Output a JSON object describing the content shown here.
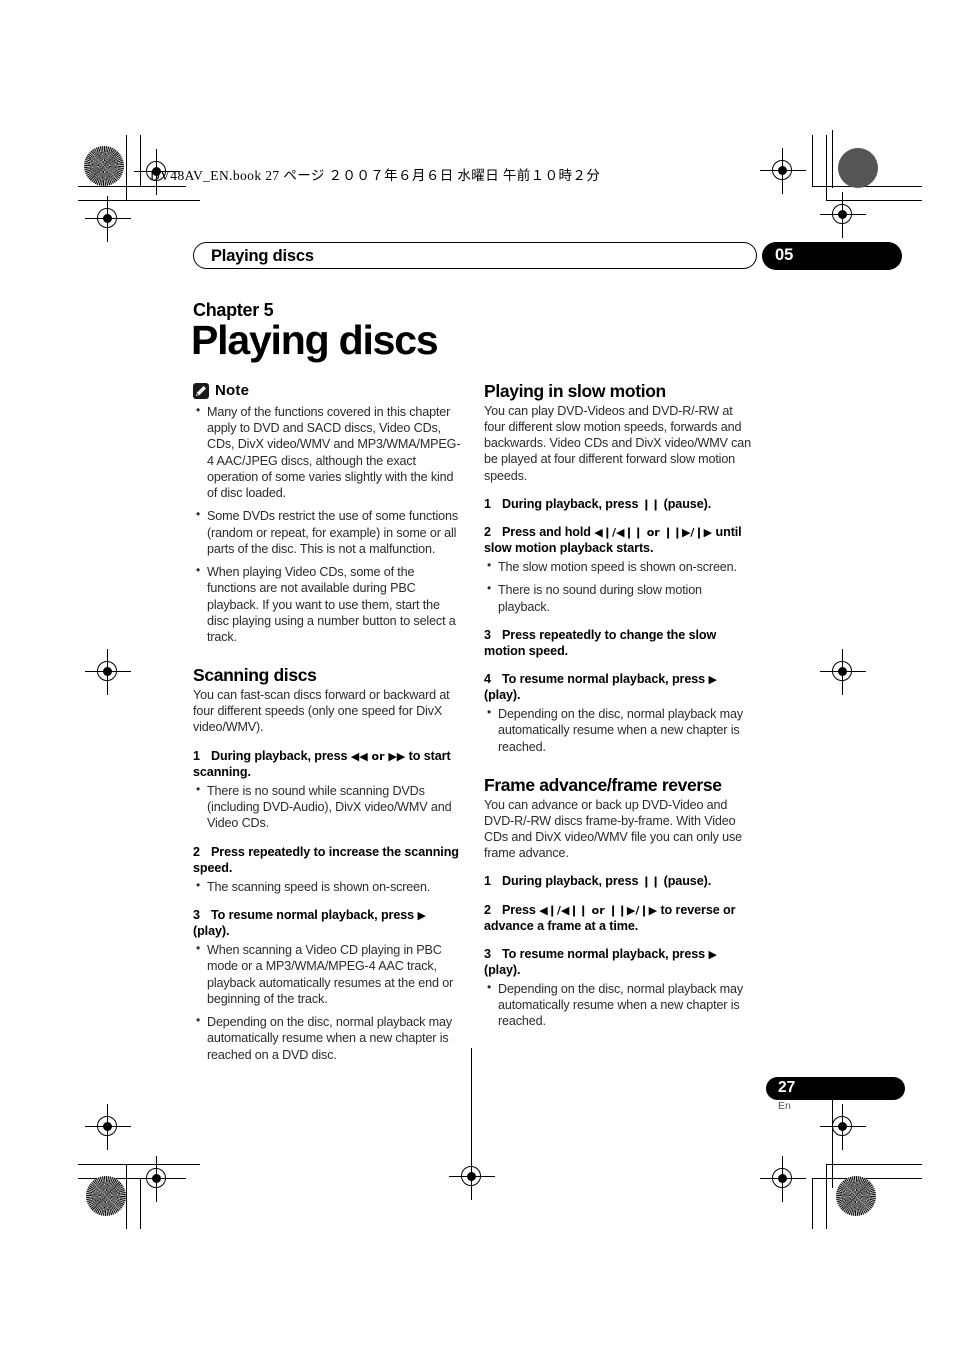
{
  "print_header": {
    "text": "DV48AV_EN.book  27 ページ  ２００７年６月６日  水曜日  午前１０時２分"
  },
  "running_header": {
    "title": "Playing discs",
    "chapter_number": "05"
  },
  "chapter": {
    "label": "Chapter 5",
    "title": "Playing discs"
  },
  "left_column": {
    "note": {
      "icon": "pencil-icon",
      "label": "Note",
      "items": [
        "Many of the functions covered in this chapter apply to DVD and SACD discs, Video CDs, CDs, DivX video/WMV and MP3/WMA/MPEG-4 AAC/JPEG discs, although the exact operation of some varies slightly with the kind of disc loaded.",
        "Some DVDs restrict the use of some functions (random or repeat, for example) in some or all parts of the disc. This is not a malfunction.",
        "When playing Video CDs, some of the functions are not available during PBC playback. If you want to use them, start the disc playing using a number button to select a track."
      ]
    },
    "scanning": {
      "heading": "Scanning discs",
      "intro": "You can fast-scan discs forward or backward at four different speeds (only one speed for DivX video/WMV).",
      "steps": [
        {
          "number": "1",
          "text_before": "During playback, press ",
          "symbol": "◀◀ or ▶▶",
          "text_after": " to start scanning.",
          "bullets": [
            "There is no sound while scanning DVDs (including DVD-Audio), DivX video/WMV and Video CDs."
          ]
        },
        {
          "number": "2",
          "text_before": "Press repeatedly to increase the scanning speed.",
          "symbol": "",
          "text_after": "",
          "bullets": [
            "The scanning speed is shown on-screen."
          ]
        },
        {
          "number": "3",
          "text_before": "To resume normal playback, press ",
          "symbol": "▶",
          "text_after": " (play).",
          "bullets": [
            "When scanning a Video CD playing in PBC mode or a MP3/WMA/MPEG-4 AAC track, playback automatically resumes at the end or beginning of the track.",
            "Depending on the disc, normal playback may automatically resume when a new chapter is reached on a DVD disc."
          ]
        }
      ]
    }
  },
  "right_column": {
    "slow_motion": {
      "heading": "Playing in slow motion",
      "intro": "You can play DVD-Videos and DVD-R/-RW at four different slow motion speeds, forwards and backwards. Video CDs and DivX video/WMV can be played at four different forward slow motion speeds.",
      "steps": [
        {
          "number": "1",
          "text_before": "During playback, press ",
          "symbol": "❙❙",
          "text_after": " (pause).",
          "bullets": []
        },
        {
          "number": "2",
          "text_before": "Press and hold ",
          "symbol": "◀❙/◀❙❙ or ❙❙▶/❙▶",
          "text_after": " until slow motion playback starts.",
          "bullets": [
            "The slow motion speed is shown on-screen.",
            "There is no sound during slow motion playback."
          ]
        },
        {
          "number": "3",
          "text_before": "Press repeatedly to change the slow motion speed.",
          "symbol": "",
          "text_after": "",
          "bullets": []
        },
        {
          "number": "4",
          "text_before": "To resume normal playback, press ",
          "symbol": "▶",
          "text_after": " (play).",
          "bullets": [
            "Depending on the disc, normal playback may automatically resume when a new chapter is reached."
          ]
        }
      ]
    },
    "frame_advance": {
      "heading": "Frame advance/frame reverse",
      "intro": "You can advance or back up DVD-Video and DVD-R/-RW discs frame-by-frame. With Video CDs and DivX video/WMV file you can only use frame advance.",
      "steps": [
        {
          "number": "1",
          "text_before": "During playback, press ",
          "symbol": "❙❙",
          "text_after": " (pause).",
          "bullets": []
        },
        {
          "number": "2",
          "text_before": "Press ",
          "symbol": "◀❙/◀❙❙ or ❙❙▶/❙▶",
          "text_after": " to reverse or advance a frame at a time.",
          "bullets": []
        },
        {
          "number": "3",
          "text_before": "To resume normal playback, press ",
          "symbol": "▶",
          "text_after": " (play).",
          "bullets": [
            "Depending on the disc, normal playback may automatically resume when a new chapter is reached."
          ]
        }
      ]
    }
  },
  "footer": {
    "page_number": "27",
    "language": "En"
  }
}
